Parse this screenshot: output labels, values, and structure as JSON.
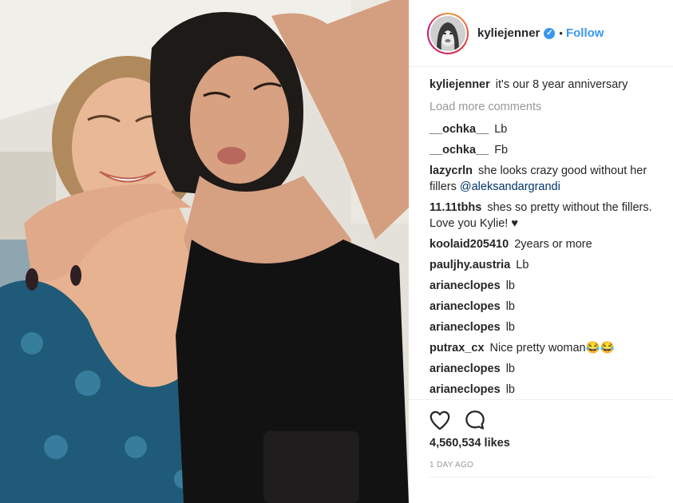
{
  "post": {
    "username": "kyliejenner",
    "verified_icon": "verified-check-icon",
    "separator": "•",
    "follow_label": "Follow",
    "caption_user": "kyliejenner",
    "caption_text": "it's our 8 year anniversary",
    "load_more": "Load more comments",
    "comments": [
      {
        "user": "__ochka__",
        "text": "Lb"
      },
      {
        "user": "__ochka__",
        "text": "Fb"
      },
      {
        "user": "lazycrln",
        "text": "she looks crazy good without her fillers",
        "mention": "@aleksandargrandi"
      },
      {
        "user": "11.11tbhs",
        "text": "shes so pretty without the fillers. Love you Kylie! ♥"
      },
      {
        "user": "koolaid205410",
        "text": "2years or more"
      },
      {
        "user": "pauljhy.austria",
        "text": "Lb"
      },
      {
        "user": "arianeclopes",
        "text": "lb"
      },
      {
        "user": "arianeclopes",
        "text": "lb"
      },
      {
        "user": "arianeclopes",
        "text": "lb"
      },
      {
        "user": "putrax_cx",
        "text": "Nice pretty woman😂😂"
      },
      {
        "user": "arianeclopes",
        "text": "lb"
      },
      {
        "user": "arianeclopes",
        "text": "lb"
      }
    ],
    "likes": "4,560,534 likes",
    "time": "1 DAY AGO",
    "like_icon": "heart-icon",
    "comment_icon": "speech-bubble-icon"
  },
  "colors": {
    "link": "#3897f0",
    "mention": "#003569",
    "muted": "#999999",
    "text": "#262626"
  }
}
